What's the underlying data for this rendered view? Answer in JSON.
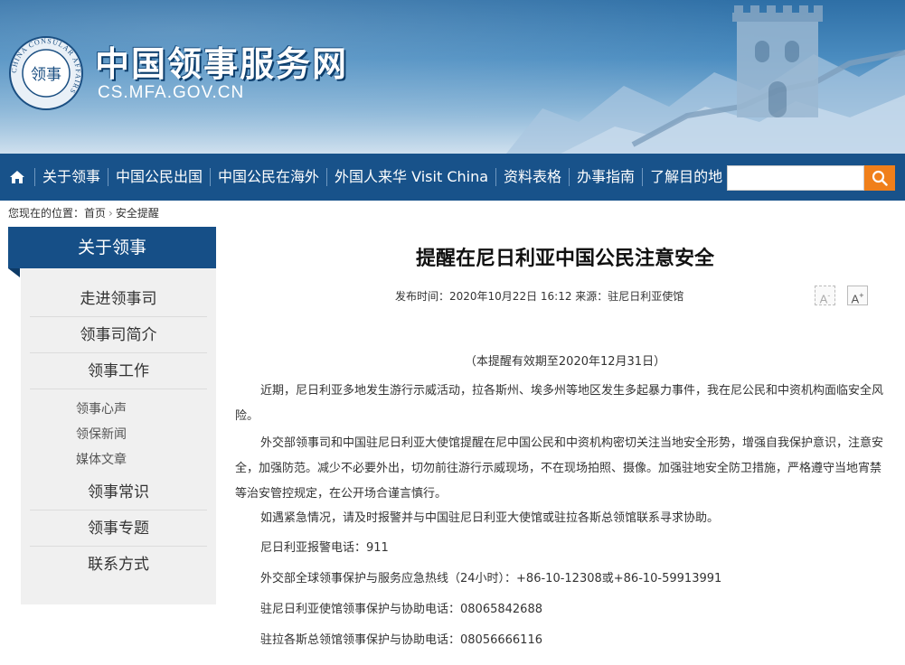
{
  "header": {
    "site_title": "中国领事服务网",
    "site_domain": "CS.MFA.GOV.CN",
    "emblem_text": "CHINA CONSULAR AFFAIRS",
    "emblem_glyphs": "领事"
  },
  "nav": {
    "home_icon": "home-icon",
    "items": [
      "关于领事",
      "中国公民出国",
      "中国公民在海外",
      "外国人来华 Visit China",
      "资料表格",
      "办事指南",
      "了解目的地"
    ],
    "search_placeholder": "",
    "search_icon": "search-icon",
    "accent": "#f07f1a",
    "bar_color": "#18528a"
  },
  "breadcrumb": {
    "prefix": "您现在的位置：",
    "home": "首页",
    "current": "安全提醒"
  },
  "sidebar": {
    "title": "关于领事",
    "items": [
      "走进领事司",
      "领事司简介",
      "领事工作"
    ],
    "sub_items": [
      "领事心声",
      "领保新闻",
      "媒体文章"
    ],
    "items_after": [
      "领事常识",
      "领事专题",
      "联系方式"
    ]
  },
  "article": {
    "title": "提醒在尼日利亚中国公民注意安全",
    "meta": "发布时间：2020年10月22日  16:12  来源：驻尼日利亚使馆",
    "font_minus": "A",
    "font_plus": "A",
    "validity": "（本提醒有效期至2020年12月31日）",
    "paragraphs": [
      "近期，尼日利亚多地发生游行示威活动，拉各斯州、埃多州等地区发生多起暴力事件，我在尼公民和中资机构面临安全风险。",
      "外交部领事司和中国驻尼日利亚大使馆提醒在尼中国公民和中资机构密切关注当地安全形势，增强自我保护意识，注意安全，加强防范。减少不必要外出，切勿前往游行示威现场，不在现场拍照、摄像。加强驻地安全防卫措施，严格遵守当地宵禁等治安管控规定，在公开场合谨言慎行。",
      "如遇紧急情况，请及时报警并与中国驻尼日利亚大使馆或驻拉各斯总领馆联系寻求协助。",
      "尼日利亚报警电话：911",
      "外交部全球领事保护与服务应急热线（24小时）：+86-10-12308或+86-10-59913991",
      "驻尼日利亚使馆领事保护与协助电话：08065842688",
      "驻拉各斯总领馆领事保护与协助电话：08056666116"
    ]
  }
}
